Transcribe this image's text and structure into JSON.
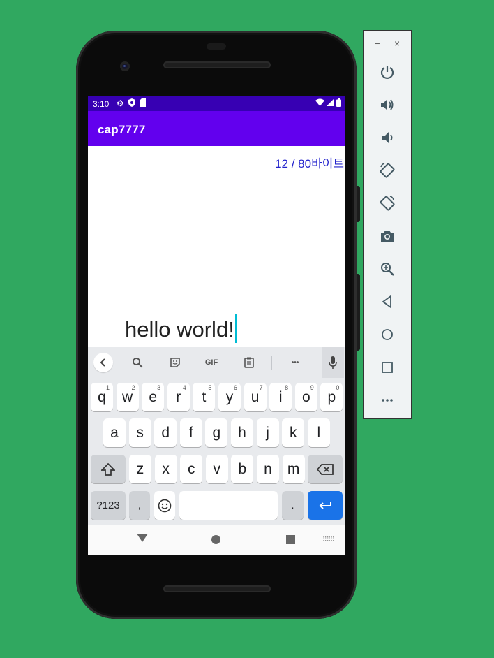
{
  "status_bar": {
    "time": "3:10"
  },
  "app": {
    "title": "cap7777"
  },
  "content": {
    "counter": "12 / 80바이트",
    "text": "hello world!"
  },
  "keyboard": {
    "suggestions": {
      "gif": "GIF",
      "more": "•••"
    },
    "row1": [
      {
        "k": "q",
        "h": "1"
      },
      {
        "k": "w",
        "h": "2"
      },
      {
        "k": "e",
        "h": "3"
      },
      {
        "k": "r",
        "h": "4"
      },
      {
        "k": "t",
        "h": "5"
      },
      {
        "k": "y",
        "h": "6"
      },
      {
        "k": "u",
        "h": "7"
      },
      {
        "k": "i",
        "h": "8"
      },
      {
        "k": "o",
        "h": "9"
      },
      {
        "k": "p",
        "h": "0"
      }
    ],
    "row2": [
      "a",
      "s",
      "d",
      "f",
      "g",
      "h",
      "j",
      "k",
      "l"
    ],
    "row3": [
      "z",
      "x",
      "c",
      "v",
      "b",
      "n",
      "m"
    ],
    "symbols": "?123",
    "comma": ",",
    "period": "."
  },
  "toolbar": {
    "minimize": "−",
    "close": "×"
  },
  "colors": {
    "background": "#30a860",
    "status": "#3700b3",
    "appbar": "#6200ee",
    "accent": "#1a73e8"
  },
  "icons": [
    "power-icon",
    "volume-up-icon",
    "volume-down-icon",
    "rotate-left-icon",
    "rotate-right-icon",
    "camera-icon",
    "zoom-icon",
    "back-icon",
    "home-icon",
    "overview-icon",
    "more-icon"
  ]
}
